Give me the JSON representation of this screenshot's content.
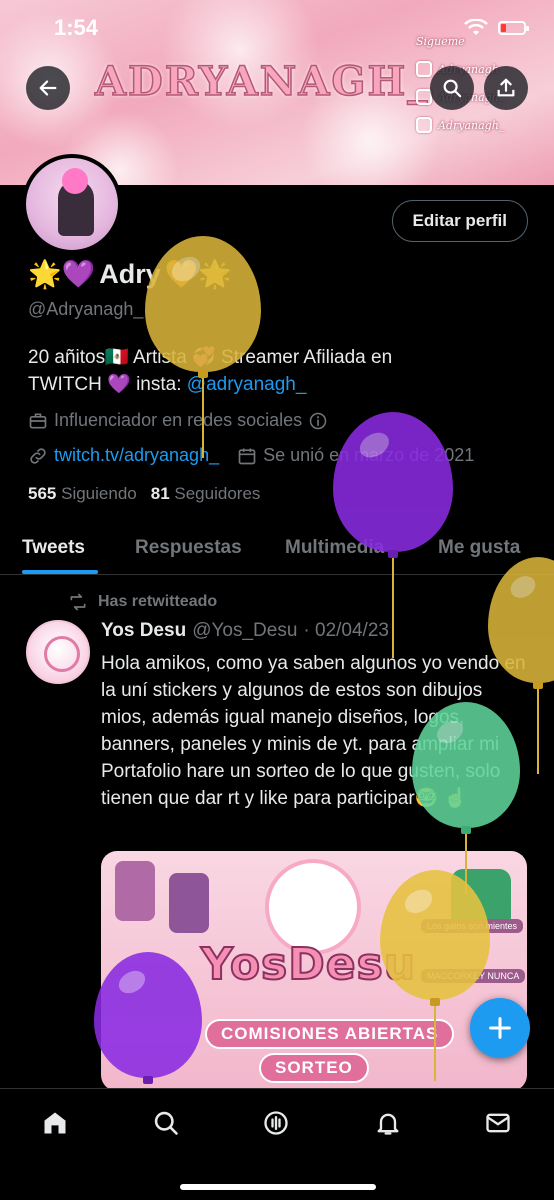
{
  "status_bar": {
    "time": "1:54"
  },
  "banner": {
    "title": "ADRYANAGH_",
    "socials": [
      "Sigueme",
      "Adryanagh",
      "Adryanagh_",
      "Adryanagh_"
    ]
  },
  "profile": {
    "name": "Adry",
    "name_emoji_left": "🌟💜",
    "name_emoji_right": "🧡🌟",
    "handle": "@Adryanagh_",
    "edit_label": "Editar perfil",
    "bio_line1": "20 añitos🇲🇽 Artista 💞 Streamer Afiliada en",
    "bio_line2_prefix": "TWITCH 💜 insta: ",
    "bio_link": "@adryanagh_",
    "category": "Influenciador en redes sociales",
    "website": "twitch.tv/adryanagh_",
    "joined": "Se unió en marzo de 2021",
    "following_count": "565",
    "following_label": "Siguiendo",
    "followers_count": "81",
    "followers_label": "Seguidores"
  },
  "tabs": [
    "Tweets",
    "Respuestas",
    "Multimedia",
    "Me gusta"
  ],
  "tweet": {
    "retweet_label": "Has retwitteado",
    "author_name": "Yos Desu",
    "author_handle": "@Yos_Desu",
    "date": "· 02/04/23",
    "text": "Hola amikos, como ya saben algunos yo vendo  en la uní stickers y algunos de estos son dibujos mios, además igual manejo diseños, logos, banners, paneles y minis de yt. para ampliar mi Portafolio hare un sorteo de lo que gusten, solo tienen que dar rt y like para participar🤓 ☝️",
    "image": {
      "logo": "YosDesu",
      "pill1": "COMISIONES ABIERTAS",
      "pill2": "SORTEO",
      "tag1": "Los gatos son mientes",
      "tag2": "MACCORKEY NUNCA"
    }
  },
  "colors": {
    "accent": "#1d9bf0",
    "balloon_yellow": "#d9b43a",
    "balloon_purple": "#8a2be2",
    "balloon_green": "#5fd39a"
  },
  "icons": {
    "back": "back-arrow-icon",
    "search": "search-icon",
    "share": "share-icon",
    "nav": [
      "home-icon",
      "search-icon",
      "spaces-icon",
      "notifications-icon",
      "messages-icon"
    ]
  }
}
